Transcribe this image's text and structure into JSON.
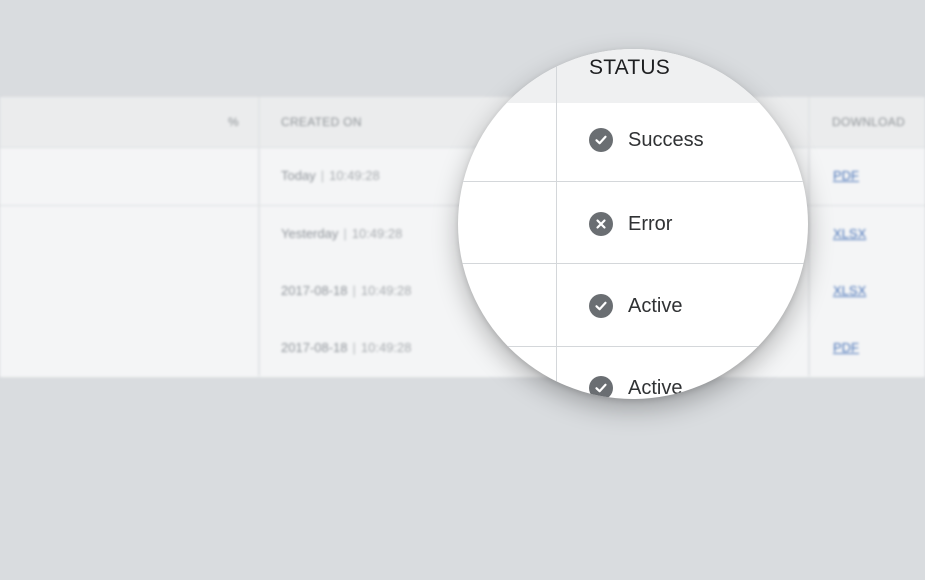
{
  "table": {
    "header": {
      "col1_marker": "%",
      "created_on": "CREATED ON",
      "download": "DOWNLOAD"
    },
    "rows": [
      {
        "date": "Today",
        "time": "10:49:28",
        "download": "PDF"
      },
      {
        "date": "Yesterday",
        "time": "10:49:28",
        "download": "XLSX"
      },
      {
        "date": "2017-08-18",
        "time": "10:49:28",
        "download": "XLSX"
      },
      {
        "date": "2017-08-18",
        "time": "10:49:28",
        "download": "PDF"
      }
    ]
  },
  "magnifier": {
    "column_title": "STATUS",
    "statuses": [
      {
        "label": "Success",
        "icon": "check-circle-icon"
      },
      {
        "label": "Error",
        "icon": "x-circle-icon"
      },
      {
        "label": "Active",
        "icon": "check-circle-icon"
      },
      {
        "label": "Active",
        "icon": "check-circle-icon"
      }
    ]
  },
  "colors": {
    "background": "#d9dcdf",
    "link": "#4a74b8",
    "status_icon": "#6a6e72"
  }
}
